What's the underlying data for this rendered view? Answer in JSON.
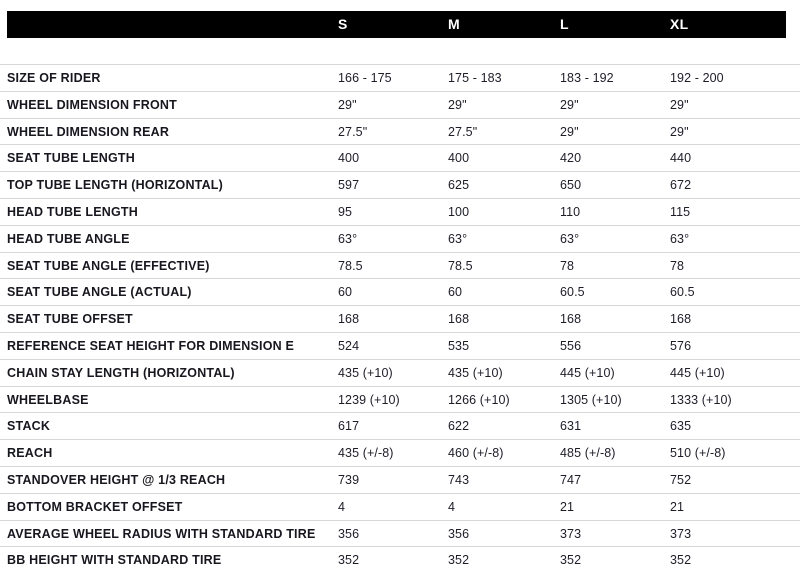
{
  "table": {
    "header": {
      "spec_label": "",
      "sizes": [
        "S",
        "M",
        "L",
        "XL"
      ]
    },
    "rows": [
      {
        "label": "SIZE OF RIDER",
        "values": [
          "166 - 175",
          "175 - 183",
          "183 - 192",
          "192 - 200"
        ]
      },
      {
        "label": "WHEEL DIMENSION FRONT",
        "values": [
          "29\"",
          "29\"",
          "29\"",
          "29\""
        ]
      },
      {
        "label": "WHEEL DIMENSION REAR",
        "values": [
          "27.5\"",
          "27.5\"",
          "29\"",
          "29\""
        ]
      },
      {
        "label": "SEAT TUBE LENGTH",
        "values": [
          "400",
          "400",
          "420",
          "440"
        ]
      },
      {
        "label": "TOP TUBE LENGTH (HORIZONTAL)",
        "values": [
          "597",
          "625",
          "650",
          "672"
        ]
      },
      {
        "label": "HEAD TUBE LENGTH",
        "values": [
          "95",
          "100",
          "110",
          "115"
        ]
      },
      {
        "label": "HEAD TUBE ANGLE",
        "values": [
          "63°",
          "63°",
          "63°",
          "63°"
        ]
      },
      {
        "label": "SEAT TUBE ANGLE (EFFECTIVE)",
        "values": [
          "78.5",
          "78.5",
          "78",
          "78"
        ]
      },
      {
        "label": "SEAT TUBE ANGLE (ACTUAL)",
        "values": [
          "60",
          "60",
          "60.5",
          "60.5"
        ]
      },
      {
        "label": "SEAT TUBE OFFSET",
        "values": [
          "168",
          "168",
          "168",
          "168"
        ]
      },
      {
        "label": "REFERENCE SEAT HEIGHT FOR DIMENSION E",
        "values": [
          "524",
          "535",
          "556",
          "576"
        ]
      },
      {
        "label": "CHAIN STAY LENGTH (HORIZONTAL)",
        "values": [
          "435 (+10)",
          "435 (+10)",
          "445 (+10)",
          "445 (+10)"
        ]
      },
      {
        "label": "WHEELBASE",
        "values": [
          "1239 (+10)",
          "1266 (+10)",
          "1305 (+10)",
          "1333 (+10)"
        ]
      },
      {
        "label": "STACK",
        "values": [
          "617",
          "622",
          "631",
          "635"
        ]
      },
      {
        "label": "REACH",
        "values": [
          "435 (+/-8)",
          "460 (+/-8)",
          "485 (+/-8)",
          "510 (+/-8)"
        ]
      },
      {
        "label": "STANDOVER HEIGHT @ 1/3 REACH",
        "values": [
          "739",
          "743",
          "747",
          "752"
        ]
      },
      {
        "label": "BOTTOM BRACKET OFFSET",
        "values": [
          "4",
          "4",
          "21",
          "21"
        ]
      },
      {
        "label": "AVERAGE WHEEL RADIUS WITH STANDARD TIRE",
        "values": [
          "356",
          "356",
          "373",
          "373"
        ]
      },
      {
        "label": "BB HEIGHT WITH STANDARD TIRE",
        "values": [
          "352",
          "352",
          "352",
          "352"
        ]
      }
    ]
  },
  "colors": {
    "header_background": "#000000",
    "header_text": "#ffffff",
    "label_text": "#17171f",
    "value_text": "#1d1d28",
    "row_divider": "#d7d7d7",
    "page_background": "#ffffff"
  }
}
